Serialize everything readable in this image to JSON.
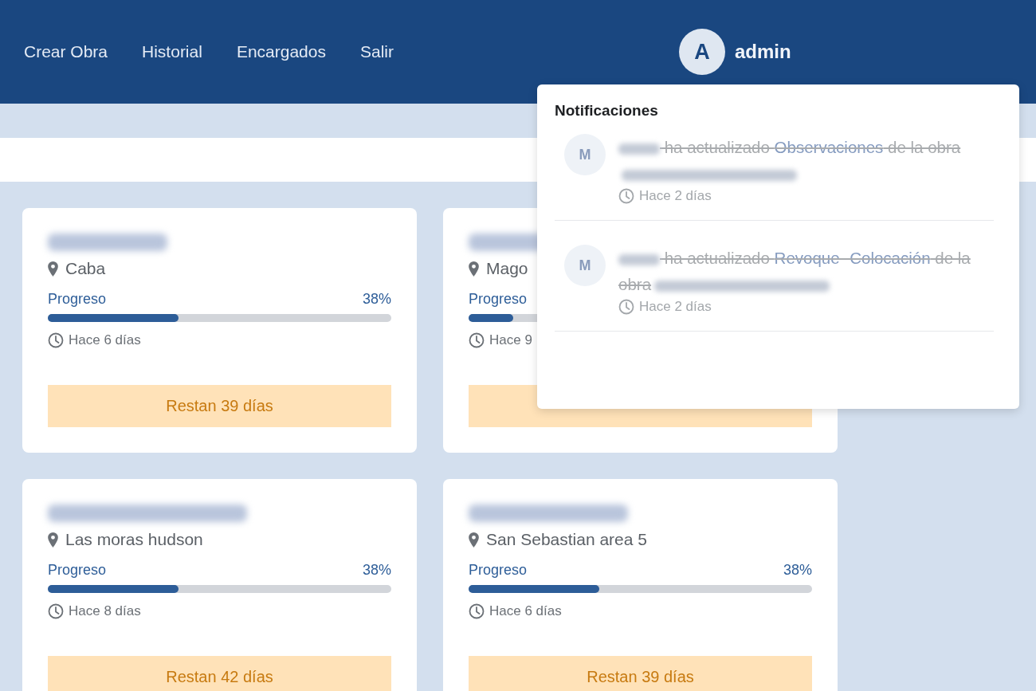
{
  "nav": {
    "links": [
      {
        "label": "Crear Obra"
      },
      {
        "label": "Historial"
      },
      {
        "label": "Encargados"
      },
      {
        "label": "Salir"
      }
    ],
    "user": {
      "initial": "A",
      "name": "admin"
    }
  },
  "notifications": {
    "title": "Notificaciones",
    "items": [
      {
        "initial": "M",
        "read": true,
        "action": "ha actualizado",
        "field": "Observaciones",
        "suffix": "de la obra",
        "time": "Hace 2 días"
      },
      {
        "initial": "M",
        "read": true,
        "action": "ha actualizado",
        "field": "Revoque- Colocación",
        "suffix": "de la obra",
        "time": "Hace 2 días"
      }
    ]
  },
  "projects": [
    {
      "location": "Caba",
      "progress_label": "Progreso",
      "percent": "38%",
      "level": 0.38,
      "time": "Hace 6 días",
      "remaining": "Restan 39 días"
    },
    {
      "location": "Mago",
      "progress_label": "Progreso",
      "level": 0.13,
      "time": "Hace 9"
    },
    {
      "location": "Las moras hudson",
      "progress_label": "Progreso",
      "percent": "38%",
      "level": 0.38,
      "time": "Hace 8 días",
      "remaining": "Restan 42 días"
    },
    {
      "location": "San Sebastian area 5",
      "progress_label": "Progreso",
      "percent": "38%",
      "level": 0.38,
      "time": "Hace 6 días",
      "remaining": "Restan 39 días"
    }
  ]
}
